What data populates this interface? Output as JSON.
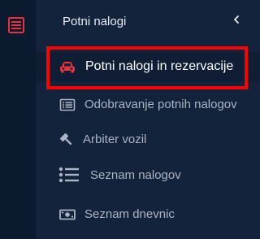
{
  "panel": {
    "title": "Potni nalogi",
    "collapse_icon": "chevron-left-icon"
  },
  "rail": {
    "icon": "list-icon",
    "icon_color": "#e8323c"
  },
  "menu": {
    "items": [
      {
        "label": "Potni nalogi in rezervacije",
        "icon": "car-icon",
        "active": true
      },
      {
        "label": "Odobravanje potnih nalogov",
        "icon": "list-alt-icon",
        "active": false
      },
      {
        "label": "Arbiter vozil",
        "icon": "gavel-icon",
        "active": false
      },
      {
        "label": "Seznam nalogov",
        "icon": "list-icon",
        "active": false
      },
      {
        "label": "Seznam dnevnic",
        "icon": "money-bill-icon",
        "active": false
      }
    ]
  },
  "colors": {
    "accent_red": "#e8323c",
    "highlight": "#ff0000",
    "background": "#0f1e35",
    "text_muted": "#aab4c3"
  }
}
